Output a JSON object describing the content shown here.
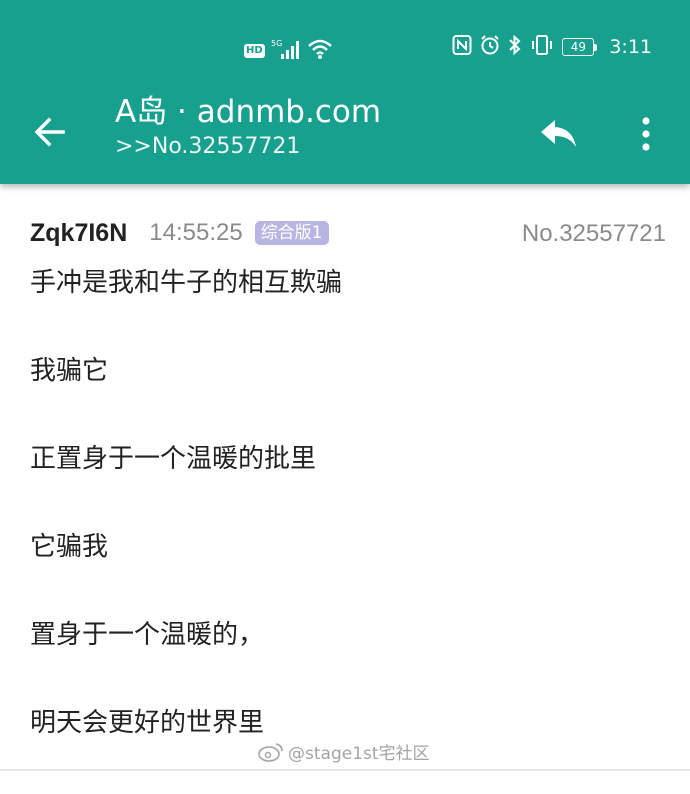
{
  "status_bar": {
    "hd": "HD",
    "net": "5G",
    "battery": "49",
    "time": "3:11"
  },
  "header": {
    "title": "A岛 · adnmb.com",
    "subtitle": ">>No.32557721"
  },
  "post": {
    "user_id": "Zqk7I6N",
    "time": "14:55:25",
    "board": "综合版1",
    "number": "No.32557721",
    "lines": [
      "手冲是我和牛子的相互欺骗",
      "我骗它",
      "正置身于一个温暖的批里",
      "它骗我",
      "置身于一个温暖的，",
      "明天会更好的世界里"
    ]
  },
  "watermark": {
    "text": "@stage1st宅社区"
  },
  "colors": {
    "accent": "#16a08d",
    "badge": "#b8b5e2",
    "text": "#222222",
    "muted": "#8a8a8a"
  }
}
